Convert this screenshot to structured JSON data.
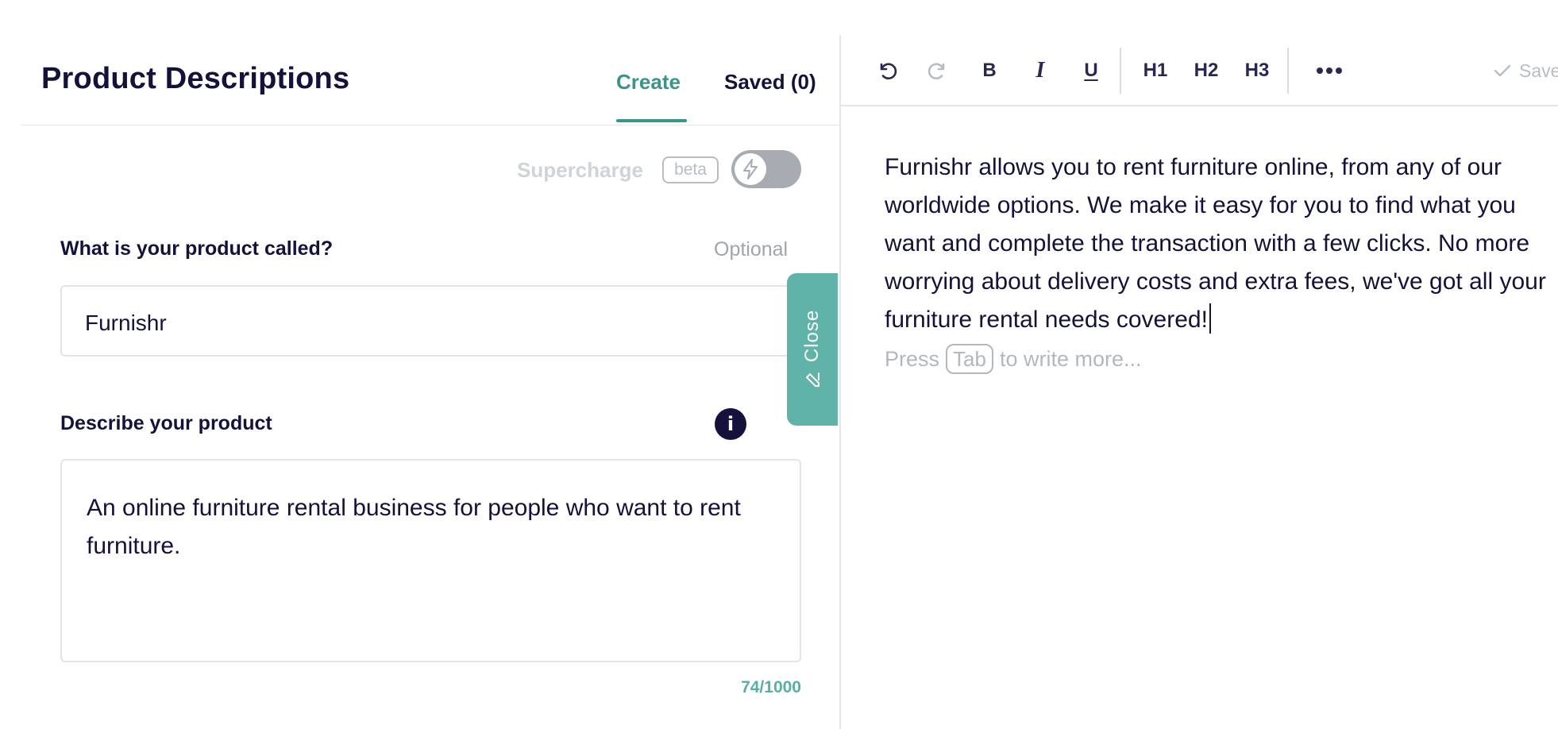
{
  "header": {
    "title": "Product Descriptions",
    "tabs": [
      {
        "label": "Create",
        "active": true
      },
      {
        "label": "Saved (0)",
        "active": false
      }
    ]
  },
  "supercharge": {
    "label": "Supercharge",
    "badge": "beta",
    "toggle_on": false,
    "toggle_icon": "lightning-icon"
  },
  "form": {
    "product_name": {
      "label": "What is your product called?",
      "optional_label": "Optional",
      "value": "Furnishr"
    },
    "description": {
      "label": "Describe your product",
      "info_icon": "i",
      "value": "An online furniture rental business for people who want to rent furniture.",
      "char_count": "74/1000"
    }
  },
  "close_tab": {
    "label": "Close",
    "icon": "pencil-icon"
  },
  "toolbar": {
    "undo_icon": "undo-icon",
    "redo_icon": "redo-icon",
    "bold_label": "B",
    "italic_label": "I",
    "underline_label": "U",
    "h1_label": "H1",
    "h2_label": "H2",
    "h3_label": "H3",
    "more_icon": "more-icon",
    "save_label": "Save"
  },
  "editor": {
    "content": "Furnishr allows you to rent furniture online, from any of our worldwide options. We make it easy for you to find what you want and complete the transaction with a few clicks. No more worrying about delivery costs and extra fees, we've got all your furniture rental needs covered!",
    "hint_prefix": "Press",
    "hint_key": "Tab",
    "hint_suffix": "to write more..."
  },
  "colors": {
    "accent": "#3a9489",
    "primary_text": "#14123d",
    "close_tab_bg": "#5fb3a9",
    "muted": "#b3b7be"
  }
}
